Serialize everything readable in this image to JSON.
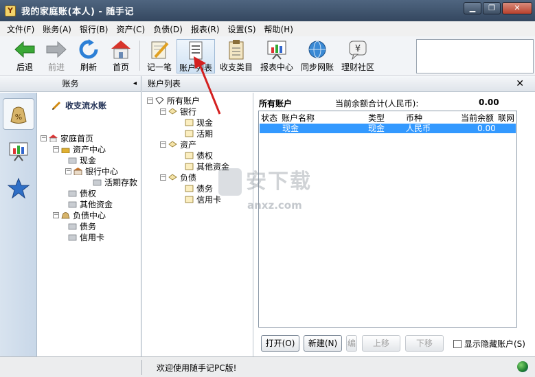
{
  "window": {
    "title": "我的家庭账(本人) - 随手记",
    "app_icon_letter": "Y",
    "minimize": "▁",
    "maximize": "❐",
    "close": "✕"
  },
  "menu": [
    "文件(F)",
    "账务(A)",
    "银行(B)",
    "资产(C)",
    "负债(D)",
    "报表(R)",
    "设置(S)",
    "帮助(H)"
  ],
  "toolbar": {
    "back": "后退",
    "forward": "前进",
    "refresh": "刷新",
    "home": "首页",
    "record": "记一笔",
    "account_list": "账户列表",
    "categories": "收支类目",
    "reports": "报表中心",
    "sync": "同步网账",
    "community": "理财社区"
  },
  "left_panel": {
    "header": "账务",
    "collapse": "◂",
    "section_title": "收支流水账",
    "tree": {
      "home": "家庭首页",
      "asset_center": "资产中心",
      "cash": "现金",
      "bank_center": "银行中心",
      "demand_deposit": "活期存款",
      "debt_claims": "债权",
      "other_funds": "其他资金",
      "liability_center": "负债中心",
      "debts": "债务",
      "credit_card": "信用卡"
    }
  },
  "main": {
    "header": "账户列表",
    "close": "✕",
    "tree": {
      "all": "所有账户",
      "bank": "银行",
      "cash": "现金",
      "demand": "活期",
      "assets": "资产",
      "claims": "债权",
      "other_funds": "其他资金",
      "liabilities": "负债",
      "debts": "债务",
      "credit_card": "信用卡"
    },
    "detail": {
      "title": "所有账户",
      "total_label": "当前余额合计(人民币):",
      "total_value": "0.00",
      "columns": {
        "status": "状态",
        "name": "账户名称",
        "type": "类型",
        "currency": "币种",
        "balance": "当前余额",
        "online": "联网"
      },
      "rows": [
        {
          "status": "",
          "name": "现金",
          "type": "现金",
          "currency": "人民币",
          "balance": "0.00",
          "online": ""
        }
      ]
    },
    "buttons": {
      "open": "打开(O)",
      "new": "新建(N)",
      "edit_partial": "编",
      "move_up": "上移",
      "move_down": "下移",
      "show_hidden": "显示隐藏账户(S)"
    }
  },
  "status": {
    "message": "欢迎使用随手记PC版!"
  },
  "watermark": {
    "main": "安下载",
    "sub": "anxz.com"
  },
  "colors": {
    "title_bar": "#3d5068",
    "selection": "#3399ff",
    "accent_red": "#d42020"
  }
}
